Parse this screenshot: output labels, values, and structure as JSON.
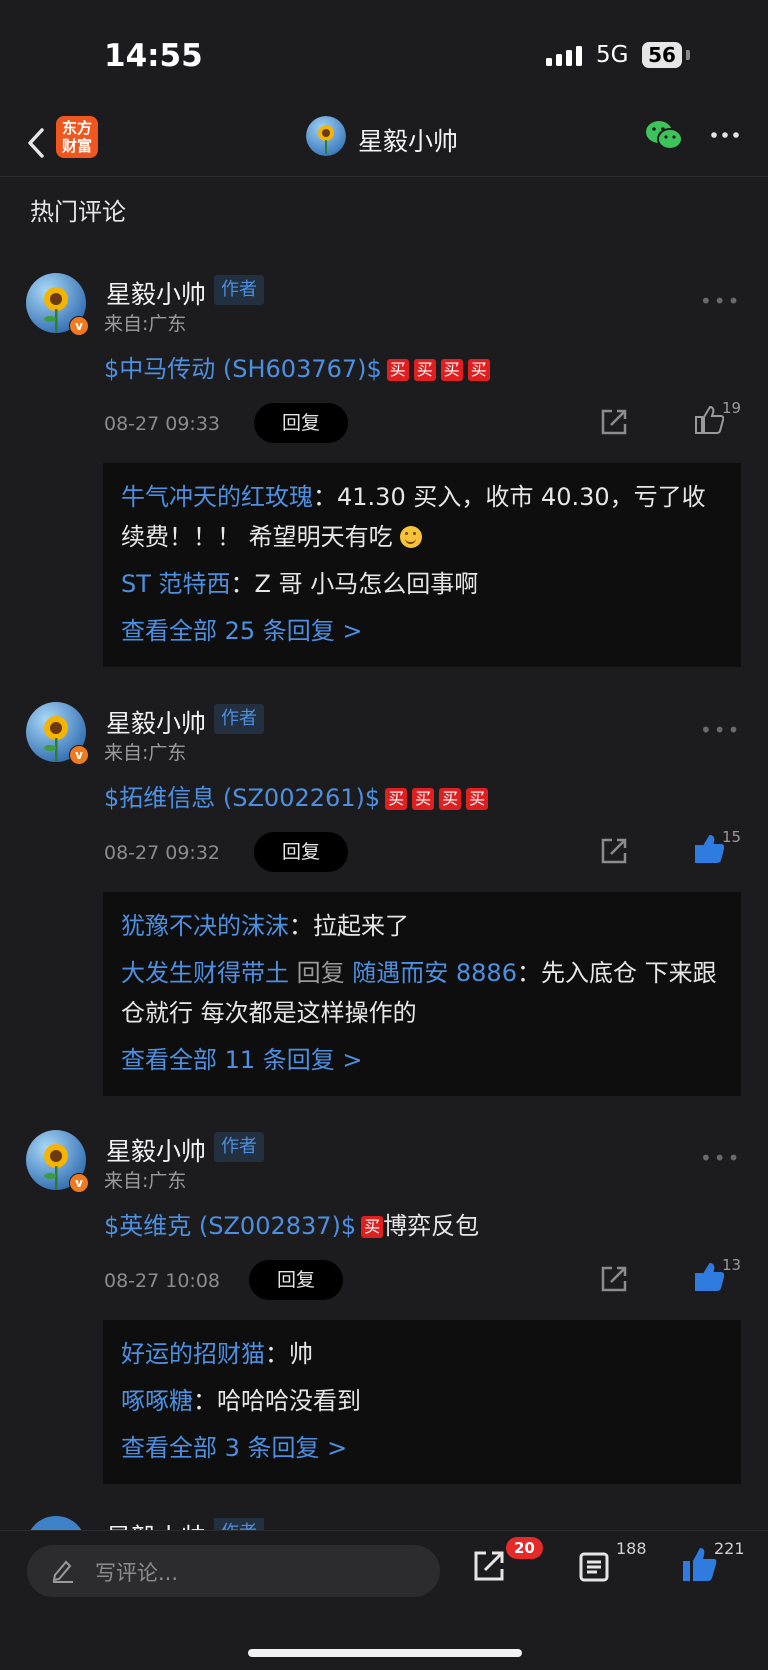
{
  "status": {
    "time": "14:55",
    "network": "5G",
    "battery": "56"
  },
  "nav": {
    "logo": "东方财富",
    "title": "星毅小帅"
  },
  "section": {
    "title": "热门评论"
  },
  "comments": [
    {
      "author": "星毅小帅",
      "tag": "作者",
      "location": "来自:广东",
      "stock": "$中马传动 (SH603767)$",
      "mai": "买",
      "text": "",
      "date": "08-27 09:33",
      "reply_label": "回复",
      "likes": "19",
      "liked": false,
      "replies": [
        {
          "user": "牛气冲天的红玫瑰",
          "colon": "：",
          "text": "41.30 买入，收市 40.30，亏了收续费！！！ 希望明天有吃"
        },
        {
          "user": "ST 范特西",
          "colon": "：",
          "text": "Z 哥   小马怎么回事啊"
        }
      ],
      "view_all": "查看全部 25 条回复 >"
    },
    {
      "author": "星毅小帅",
      "tag": "作者",
      "location": "来自:广东",
      "stock": "$拓维信息 (SZ002261)$",
      "mai": "买",
      "text": "",
      "date": "08-27 09:32",
      "reply_label": "回复",
      "likes": "15",
      "liked": true,
      "replies": [
        {
          "user": "犹豫不决的沫沫",
          "colon": "：",
          "text": "拉起来了"
        },
        {
          "user": "大发生财得带土",
          "mid": " 回复 ",
          "user2": "随遇而安 8886",
          "colon": "：",
          "text": "先入底仓  下来跟仓就行 每次都是这样操作的"
        }
      ],
      "view_all": "查看全部 11 条回复 >"
    },
    {
      "author": "星毅小帅",
      "tag": "作者",
      "location": "来自:广东",
      "stock": "$英维克 (SZ002837)$",
      "mai": "买",
      "text": "博弈反包",
      "date": "08-27 10:08",
      "reply_label": "回复",
      "likes": "13",
      "liked": true,
      "replies": [
        {
          "user": "好运的招财猫",
          "colon": "：",
          "text": "帅"
        },
        {
          "user": "啄啄糖",
          "colon": "：",
          "text": "哈哈哈没看到"
        }
      ],
      "view_all": "查看全部 3 条回复 >"
    }
  ],
  "peek": {
    "author": "星毅小帅",
    "tag": "作者"
  },
  "bottom_bar": {
    "placeholder": "写评论...",
    "share_count": "20",
    "comment_count": "188",
    "like_count": "221"
  },
  "colors": {
    "background": "#1c1c1e",
    "link_blue": "#4d8fe0",
    "buy_red": "#e02020",
    "badge_red": "#e52a2a",
    "logo_orange": "#f0571e"
  }
}
